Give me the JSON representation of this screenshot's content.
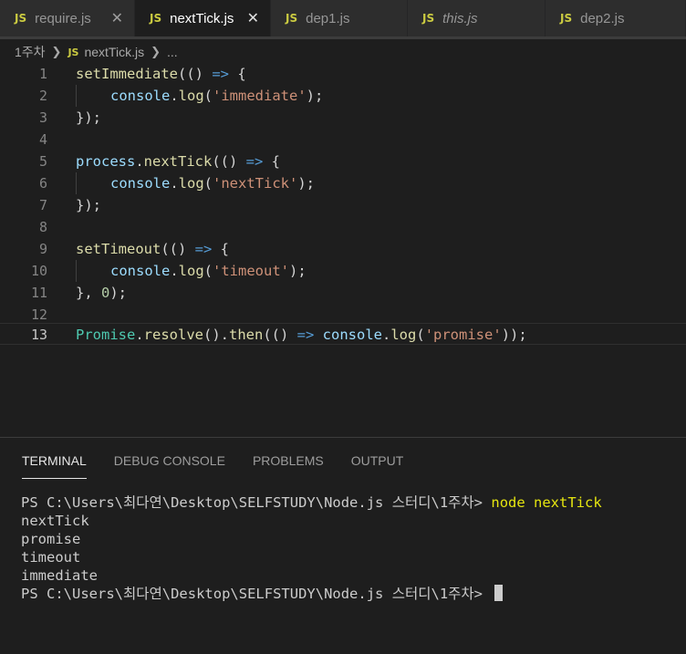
{
  "tabs": [
    {
      "name": "require.js",
      "icon": "JS",
      "active": false,
      "italic": false,
      "close": "✕"
    },
    {
      "name": "nextTick.js",
      "icon": "JS",
      "active": true,
      "italic": false,
      "close": "✕"
    },
    {
      "name": "dep1.js",
      "icon": "JS",
      "active": false,
      "italic": false
    },
    {
      "name": "this.js",
      "icon": "JS",
      "active": false,
      "italic": true
    },
    {
      "name": "dep2.js",
      "icon": "JS",
      "active": false,
      "italic": false
    }
  ],
  "breadcrumb": {
    "folder": "1주차",
    "icon": "JS",
    "file": "nextTick.js",
    "more": "..."
  },
  "editor": {
    "line_numbers": [
      "1",
      "2",
      "3",
      "4",
      "5",
      "6",
      "7",
      "8",
      "9",
      "10",
      "11",
      "12",
      "13"
    ],
    "active_line": "13",
    "code": {
      "l1_fn": "setImmediate",
      "l1_a": "(() ",
      "l1_arrow": "=>",
      "l1_b": " {",
      "l2_obj": "console",
      "l2_dot": ".",
      "l2_fn": "log",
      "l2_p1": "(",
      "l2_str": "'immediate'",
      "l2_p2": ");",
      "l3": "});",
      "l5_obj": "process",
      "l5_dot": ".",
      "l5_fn": "nextTick",
      "l5_a": "(() ",
      "l5_arrow": "=>",
      "l5_b": " {",
      "l6_obj": "console",
      "l6_dot": ".",
      "l6_fn": "log",
      "l6_p1": "(",
      "l6_str": "'nextTick'",
      "l6_p2": ");",
      "l7": "});",
      "l9_fn": "setTimeout",
      "l9_a": "(() ",
      "l9_arrow": "=>",
      "l9_b": " {",
      "l10_obj": "console",
      "l10_dot": ".",
      "l10_fn": "log",
      "l10_p1": "(",
      "l10_str": "'timeout'",
      "l10_p2": ");",
      "l11_a": "}, ",
      "l11_num": "0",
      "l11_b": ");",
      "l13_cls": "Promise",
      "l13_dot1": ".",
      "l13_fn1": "resolve",
      "l13_a": "().",
      "l13_fn2": "then",
      "l13_b": "(() ",
      "l13_arrow": "=>",
      "l13_sp": " ",
      "l13_obj": "console",
      "l13_dot2": ".",
      "l13_fn3": "log",
      "l13_c": "(",
      "l13_str": "'promise'",
      "l13_d": "));"
    }
  },
  "panel": {
    "tabs": [
      "TERMINAL",
      "DEBUG CONSOLE",
      "PROBLEMS",
      "OUTPUT"
    ],
    "active_tab": "TERMINAL"
  },
  "terminal": {
    "prompt": "PS C:\\Users\\최다연\\Desktop\\SELFSTUDY\\Node.js 스터디\\1주차> ",
    "command": "node nextTick",
    "output": [
      "nextTick",
      "promise",
      "timeout",
      "immediate"
    ]
  },
  "colors": {
    "js_icon": "#cbcb41",
    "function": "#dcdcaa",
    "variable": "#9cdcfe",
    "string": "#ce9178",
    "number": "#b5cea8",
    "class": "#4ec9b0",
    "keyword": "#569cd6",
    "command": "#e5e510"
  }
}
